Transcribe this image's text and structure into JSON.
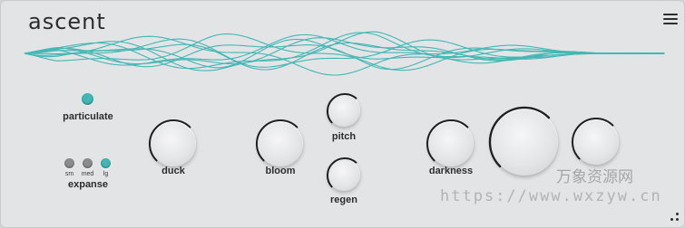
{
  "app": {
    "logo": "ascent"
  },
  "colors": {
    "accent": "#43b7b4",
    "led_off": "#8b8c8f",
    "knob_arc": "#1f2023",
    "panel": "#e3e4e6"
  },
  "icons": {
    "menu": "hamburger-menu-icon",
    "corner": "resize-grip-icon"
  },
  "particulate": {
    "label": "particulate",
    "on": true
  },
  "expanse": {
    "label": "expanse",
    "options": [
      "sm",
      "med",
      "lg"
    ],
    "selected": "lg"
  },
  "knobs": {
    "duck": {
      "label": "duck"
    },
    "bloom": {
      "label": "bloom"
    },
    "pitch": {
      "label": "pitch"
    },
    "regen": {
      "label": "regen"
    },
    "darkness": {
      "label": "darkness"
    },
    "main": {
      "label": ""
    },
    "right": {
      "label": ""
    }
  },
  "watermark": {
    "line1": "万象资源网",
    "line2": "https://www.wxzyw.cn"
  }
}
